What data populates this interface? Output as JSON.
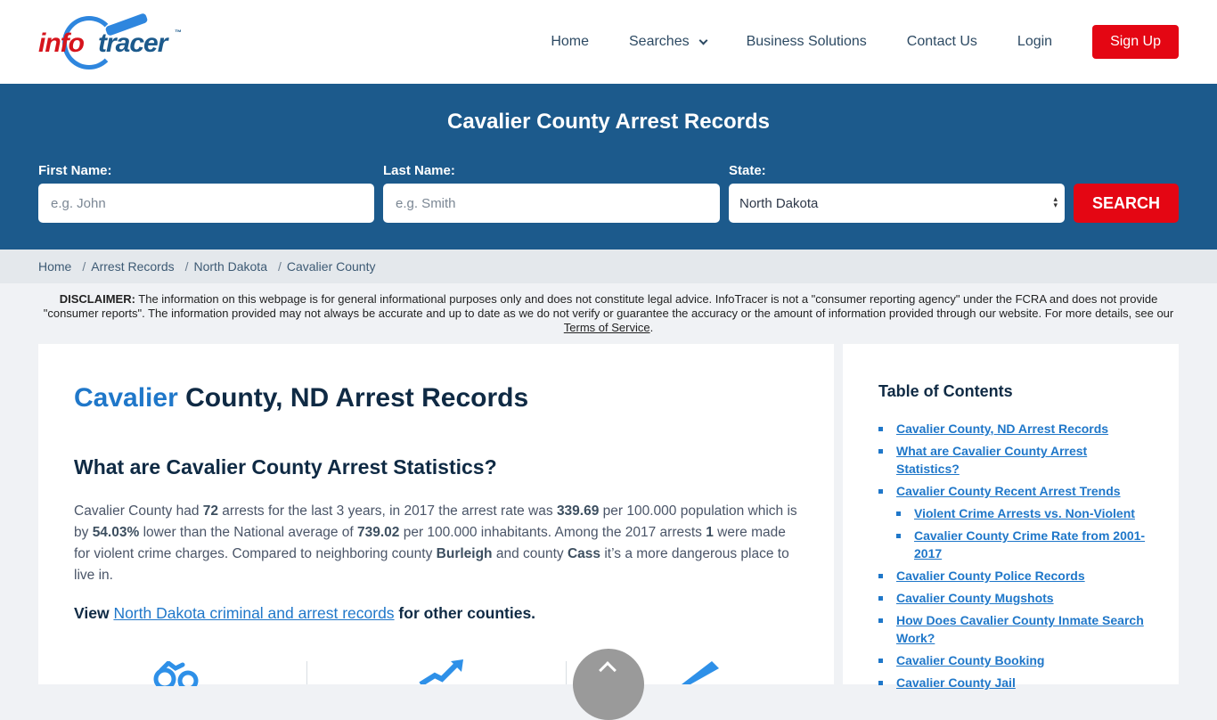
{
  "brand": {
    "name_part1": "info",
    "name_part2": "tracer",
    "tm": "™",
    "accent_red": "#e40613",
    "accent_blue": "#1c5a8c",
    "link_blue": "#1f77c9"
  },
  "nav": {
    "items": [
      "Home",
      "Searches",
      "Business Solutions",
      "Contact Us",
      "Login"
    ],
    "signup": "Sign Up"
  },
  "search": {
    "title": "Cavalier County Arrest Records",
    "first_name_label": "First Name:",
    "first_name_placeholder": "e.g. John",
    "last_name_label": "Last Name:",
    "last_name_placeholder": "e.g. Smith",
    "state_label": "State:",
    "state_value": "North Dakota",
    "button": "SEARCH"
  },
  "breadcrumb": [
    "Home",
    "Arrest Records",
    "North Dakota",
    "Cavalier County"
  ],
  "disclaimer": {
    "label": "DISCLAIMER:",
    "text": " The information on this webpage is for general informational purposes only and does not constitute legal advice. InfoTracer is not a \"consumer reporting agency\" under the FCRA and does not provide \"consumer reports\". The information provided may not always be accurate and up to date as we do not verify or guarantee the accuracy or the amount of information provided through our website. For more details, see our ",
    "link": "Terms of Service",
    "end": "."
  },
  "main": {
    "h1_accent": "Cavalier",
    "h1_rest": " County, ND Arrest Records",
    "h2": "What are Cavalier County Arrest Statistics?",
    "para": {
      "t1": "Cavalier County had ",
      "arrests": "72",
      "t2": " arrests for the last 3 years, in 2017 the arrest rate was ",
      "rate": "339.69",
      "t3": " per 100.000 population which is by ",
      "pct": "54.03%",
      "t4": " lower than the National average of ",
      "national": "739.02",
      "t5": " per 100.000 inhabitants. Among the 2017 arrests ",
      "violent": "1",
      "t6": " were made for violent crime charges. Compared to neighboring county ",
      "county1": "Burleigh",
      "t7": " and county ",
      "county2": "Cass",
      "t8": " it’s a more dangerous place to live in."
    },
    "view_prefix": "View ",
    "view_link": "North Dakota criminal and arrest records",
    "view_suffix": " for other counties."
  },
  "toc": {
    "title": "Table of Contents",
    "items": [
      {
        "label": "Cavalier County, ND Arrest Records",
        "level": 1
      },
      {
        "label": "What are Cavalier County Arrest Statistics?",
        "level": 1
      },
      {
        "label": "Cavalier County Recent Arrest Trends",
        "level": 1
      },
      {
        "label": "Violent Crime Arrests vs. Non-Violent",
        "level": 2
      },
      {
        "label": "Cavalier County Crime Rate from 2001-2017",
        "level": 2
      },
      {
        "label": "Cavalier County Police Records",
        "level": 1
      },
      {
        "label": "Cavalier County Mugshots",
        "level": 1
      },
      {
        "label": "How Does Cavalier County Inmate Search Work?",
        "level": 1
      },
      {
        "label": "Cavalier County Booking",
        "level": 1
      },
      {
        "label": "Cavalier County Jail",
        "level": 1
      }
    ]
  },
  "icons": [
    "handcuffs-icon",
    "trend-arrow-icon",
    "gun-icon",
    "scroll-top-icon"
  ]
}
